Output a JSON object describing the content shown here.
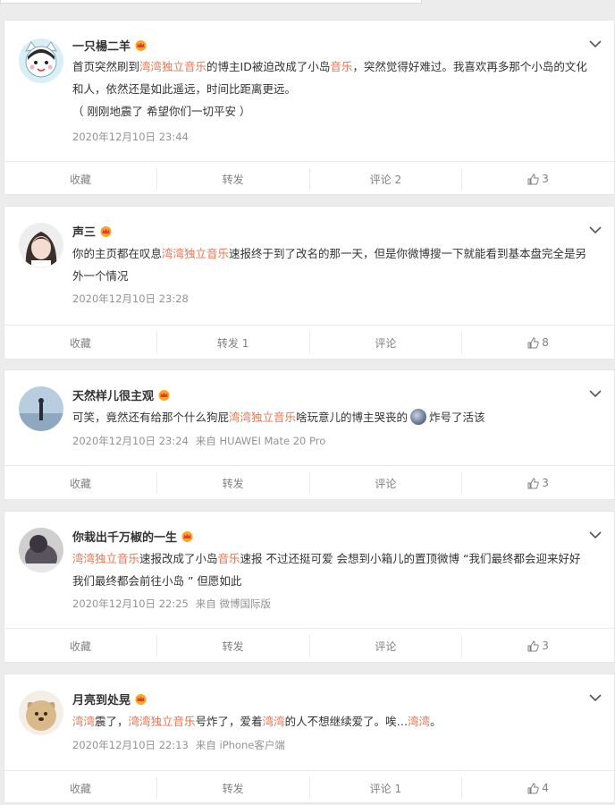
{
  "posts": [
    {
      "username": "一只楊二羊",
      "text_segments": [
        {
          "t": "首页突然刷到"
        },
        {
          "t": "湾湾独立音乐",
          "hl": true
        },
        {
          "t": "的博主ID被迫改成了小岛"
        },
        {
          "t": "音乐",
          "hl": true
        },
        {
          "t": "，突然觉得好难过。我喜欢再多那个小岛的文化和人，依然还是如此遥远，时间比距离更远。"
        },
        {
          "t": "\n（ 刚刚地震了 希望你们一切平安 ）"
        }
      ],
      "time": "2020年12月10日 23:44",
      "source": "",
      "actions": {
        "favorite": "收藏",
        "repost": "转发",
        "comment": "评论 2",
        "like": "3"
      }
    },
    {
      "username": "声三",
      "text_segments": [
        {
          "t": "你的主页都在叹息"
        },
        {
          "t": "湾湾独立音乐",
          "hl": true
        },
        {
          "t": "速报终于到了改名的那一天，但是你微博搜一下就能看到基本盘完全是另外一个情况"
        }
      ],
      "time": "2020年12月10日 23:28",
      "source": "",
      "actions": {
        "favorite": "收藏",
        "repost": "转发 1",
        "comment": "评论",
        "like": "8"
      }
    },
    {
      "username": "天然样儿很主观",
      "text_segments": [
        {
          "t": "可笑，竟然还有给那个什么狗屁"
        },
        {
          "t": "湾湾独立音乐",
          "hl": true
        },
        {
          "t": "啥玩意儿的博主哭丧的"
        },
        {
          "t": "",
          "emoji": true
        },
        {
          "t": "炸号了活该"
        }
      ],
      "time": "2020年12月10日 23:24",
      "source": "来自 HUAWEI Mate 20 Pro",
      "actions": {
        "favorite": "收藏",
        "repost": "转发",
        "comment": "评论",
        "like": "3"
      }
    },
    {
      "username": "你栽出千万椒的一生",
      "text_segments": [
        {
          "t": "湾湾独立音乐",
          "hl": true
        },
        {
          "t": "速报改成了小岛"
        },
        {
          "t": "音乐",
          "hl": true
        },
        {
          "t": "速报 不过还挺可爱 会想到小箱儿的置顶微博 “我们最终都会迎来好好 我们最终都会前往小岛 ” 但愿如此"
        }
      ],
      "time": "2020年12月10日 22:25",
      "source": "来自 微博国际版",
      "actions": {
        "favorite": "收藏",
        "repost": "转发",
        "comment": "评论",
        "like": "3"
      }
    },
    {
      "username": "月亮到处晃",
      "text_segments": [
        {
          "t": "湾湾",
          "hl": true
        },
        {
          "t": "震了，"
        },
        {
          "t": "湾湾独立音乐",
          "hl": true
        },
        {
          "t": "号炸了，爱着"
        },
        {
          "t": "湾湾",
          "hl": true
        },
        {
          "t": "的人不想继续爱了。唉…"
        },
        {
          "t": "湾湾",
          "hl": true
        },
        {
          "t": "。"
        }
      ],
      "time": "2020年12月10日 22:13",
      "source": "来自 iPhone客户端",
      "actions": {
        "favorite": "收藏",
        "repost": "转发",
        "comment": "评论 1",
        "like": "4"
      }
    }
  ],
  "icons": {
    "vip": "crown-vip-icon",
    "more": "chevron-down-icon",
    "like": "thumbs-up-icon"
  },
  "colors": {
    "highlight": "#eb7350",
    "name": "#333333",
    "meta": "#939393",
    "action": "#808080"
  }
}
